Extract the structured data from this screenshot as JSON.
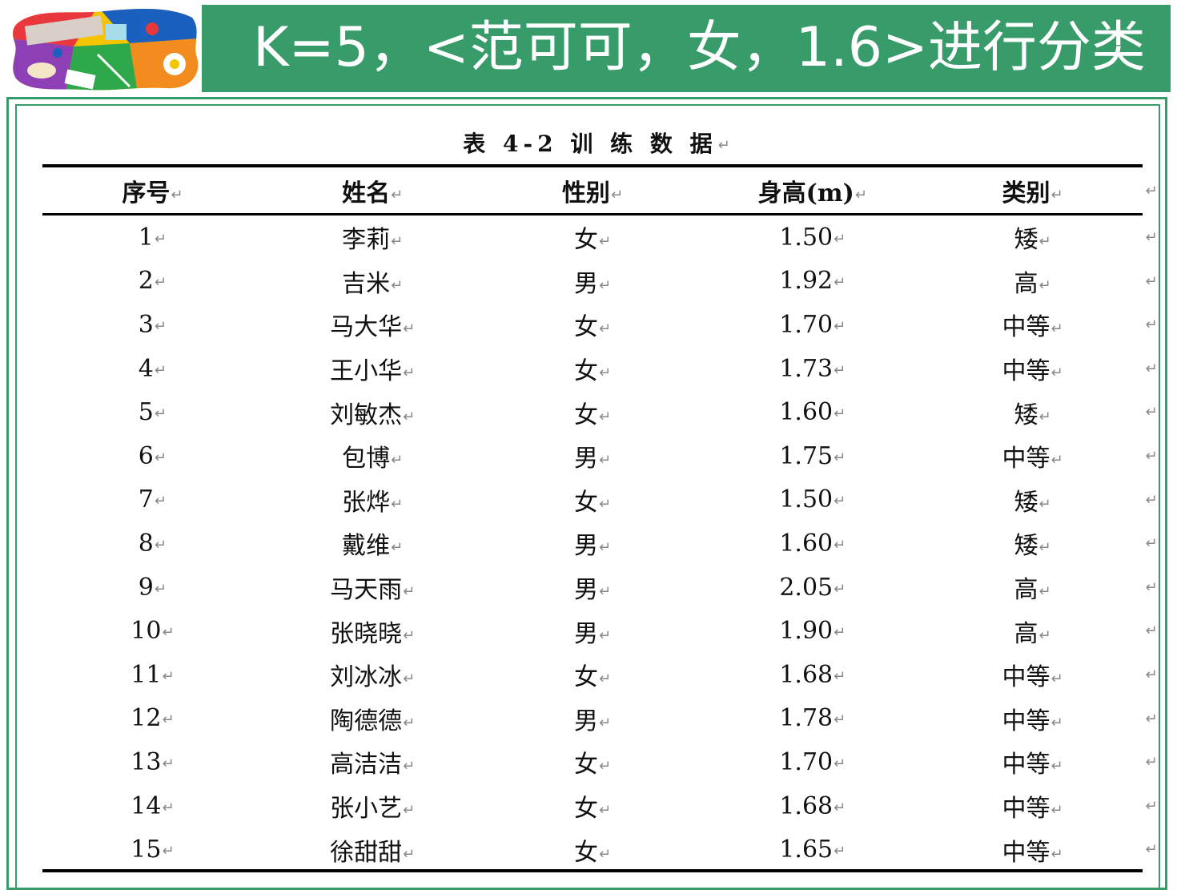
{
  "header": {
    "title": "K=5，<范可可，女，1.6>进行分类"
  },
  "logo": {
    "icon": "food-collage-logo",
    "colors": [
      "#E8383D",
      "#1B5FBF",
      "#F5C400",
      "#2EA84A",
      "#F28C1E",
      "#A7DDEA"
    ]
  },
  "theme": {
    "accent": "#389B6A"
  },
  "table": {
    "caption": "表 4-2  训 练 数 据",
    "paragraph_mark": "↵",
    "headers": [
      "序号",
      "姓名",
      "性别",
      "身高(m)",
      "类别"
    ],
    "rows": [
      [
        "1",
        "李莉",
        "女",
        "1.50",
        "矮"
      ],
      [
        "2",
        "吉米",
        "男",
        "1.92",
        "高"
      ],
      [
        "3",
        "马大华",
        "女",
        "1.70",
        "中等"
      ],
      [
        "4",
        "王小华",
        "女",
        "1.73",
        "中等"
      ],
      [
        "5",
        "刘敏杰",
        "女",
        "1.60",
        "矮"
      ],
      [
        "6",
        "包博",
        "男",
        "1.75",
        "中等"
      ],
      [
        "7",
        "张烨",
        "女",
        "1.50",
        "矮"
      ],
      [
        "8",
        "戴维",
        "男",
        "1.60",
        "矮"
      ],
      [
        "9",
        "马天雨",
        "男",
        "2.05",
        "高"
      ],
      [
        "10",
        "张晓晓",
        "男",
        "1.90",
        "高"
      ],
      [
        "11",
        "刘冰冰",
        "女",
        "1.68",
        "中等"
      ],
      [
        "12",
        "陶德德",
        "男",
        "1.78",
        "中等"
      ],
      [
        "13",
        "高洁洁",
        "女",
        "1.70",
        "中等"
      ],
      [
        "14",
        "张小艺",
        "女",
        "1.68",
        "中等"
      ],
      [
        "15",
        "徐甜甜",
        "女",
        "1.65",
        "中等"
      ]
    ]
  }
}
